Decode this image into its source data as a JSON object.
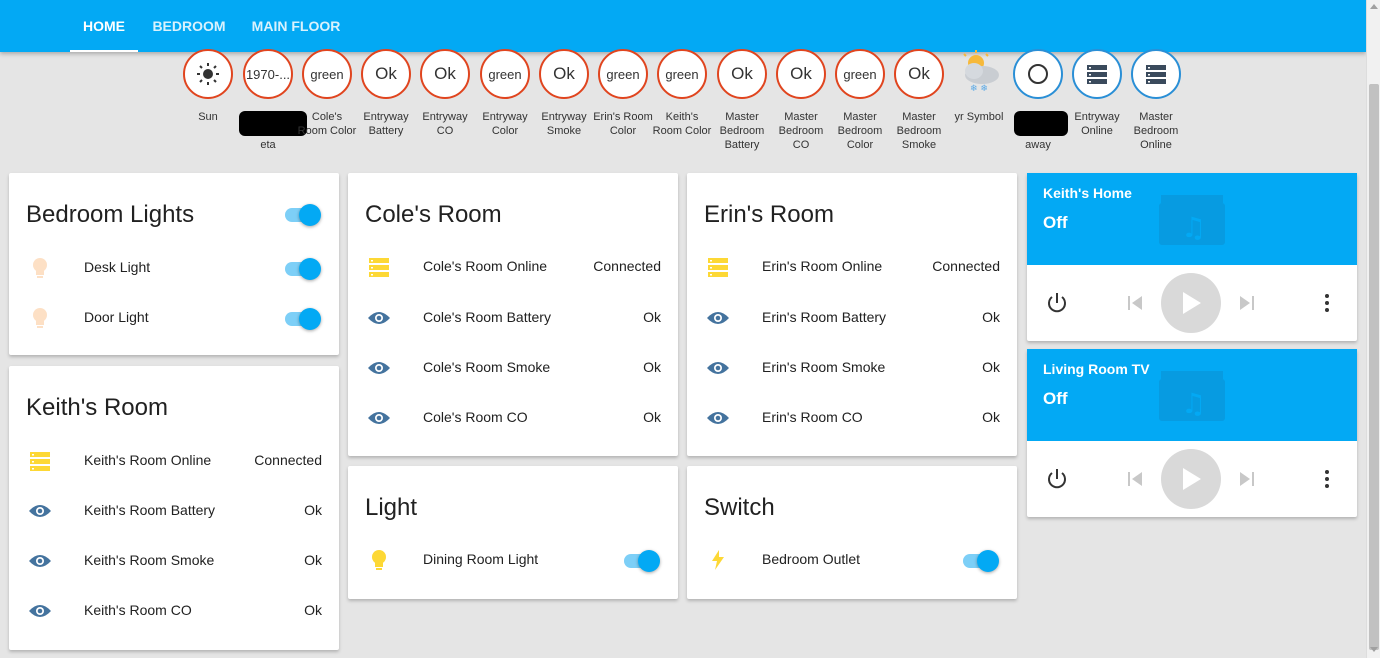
{
  "tabs": [
    {
      "label": "Home"
    },
    {
      "label": "Bedroom"
    },
    {
      "label": "Main Floor"
    }
  ],
  "badges": [
    {
      "value": "",
      "label": "Sun",
      "border": "red",
      "icon": "sun-icon"
    },
    {
      "value": "1970-...",
      "label": "eta",
      "border": "red"
    },
    {
      "value": "green",
      "label": "Cole's Room Color",
      "border": "red"
    },
    {
      "value": "Ok",
      "label": "Entryway Battery",
      "border": "red"
    },
    {
      "value": "Ok",
      "label": "Entryway CO",
      "border": "red"
    },
    {
      "value": "green",
      "label": "Entryway Color",
      "border": "red"
    },
    {
      "value": "Ok",
      "label": "Entryway Smoke",
      "border": "red"
    },
    {
      "value": "green",
      "label": "Erin's Room Color",
      "border": "red"
    },
    {
      "value": "green",
      "label": "Keith's Room Color",
      "border": "red"
    },
    {
      "value": "Ok",
      "label": "Master Bedroom Battery",
      "border": "red"
    },
    {
      "value": "Ok",
      "label": "Master Bedroom CO",
      "border": "red"
    },
    {
      "value": "green",
      "label": "Master Bedroom Color",
      "border": "red"
    },
    {
      "value": "Ok",
      "label": "Master Bedroom Smoke",
      "border": "red"
    },
    {
      "value": "",
      "label": "yr Symbol",
      "border": "none",
      "icon": "weather-icon"
    },
    {
      "value": "",
      "label": "away",
      "border": "blue",
      "icon": "circle-icon"
    },
    {
      "value": "",
      "label": "Entryway Online",
      "border": "blue",
      "icon": "server-icon"
    },
    {
      "value": "",
      "label": "Master Bedroom Online",
      "border": "blue",
      "icon": "server-icon"
    }
  ],
  "bedroom_lights": {
    "title": "Bedroom Lights",
    "items": [
      {
        "name": "Desk Light",
        "on": true
      },
      {
        "name": "Door Light",
        "on": true
      }
    ]
  },
  "keiths_room": {
    "title": "Keith's Room",
    "items": [
      {
        "name": "Keith's Room Online",
        "value": "Connected"
      },
      {
        "name": "Keith's Room Battery",
        "value": "Ok"
      },
      {
        "name": "Keith's Room Smoke",
        "value": "Ok"
      },
      {
        "name": "Keith's Room CO",
        "value": "Ok"
      }
    ]
  },
  "coles_room": {
    "title": "Cole's Room",
    "items": [
      {
        "name": "Cole's Room Online",
        "value": "Connected"
      },
      {
        "name": "Cole's Room Battery",
        "value": "Ok"
      },
      {
        "name": "Cole's Room Smoke",
        "value": "Ok"
      },
      {
        "name": "Cole's Room CO",
        "value": "Ok"
      }
    ]
  },
  "erins_room": {
    "title": "Erin's Room",
    "items": [
      {
        "name": "Erin's Room Online",
        "value": "Connected"
      },
      {
        "name": "Erin's Room Battery",
        "value": "Ok"
      },
      {
        "name": "Erin's Room Smoke",
        "value": "Ok"
      },
      {
        "name": "Erin's Room CO",
        "value": "Ok"
      }
    ]
  },
  "light_card": {
    "title": "Light",
    "items": [
      {
        "name": "Dining Room Light",
        "on": true
      }
    ]
  },
  "switch_card": {
    "title": "Switch",
    "items": [
      {
        "name": "Bedroom Outlet",
        "on": true
      }
    ]
  },
  "media": [
    {
      "title": "Keith's Home",
      "state": "Off"
    },
    {
      "title": "Living Room TV",
      "state": "Off"
    }
  ],
  "colors": {
    "accent": "#03a9f4",
    "badge_red": "#e0451f",
    "badge_blue": "#2a8fd6",
    "server_yellow": "#fdd835",
    "eye_blue": "#44739e",
    "bulb_off": "#fde0c5"
  }
}
